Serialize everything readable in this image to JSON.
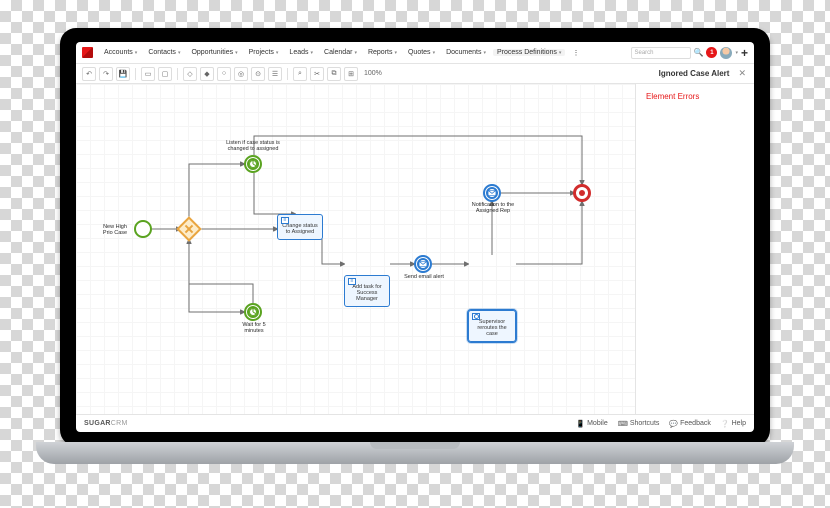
{
  "brand": {
    "strong": "SUGAR",
    "light": "CRM"
  },
  "nav": {
    "items": [
      {
        "label": "Accounts"
      },
      {
        "label": "Contacts"
      },
      {
        "label": "Opportunities"
      },
      {
        "label": "Projects"
      },
      {
        "label": "Leads"
      },
      {
        "label": "Calendar"
      },
      {
        "label": "Reports"
      },
      {
        "label": "Quotes"
      },
      {
        "label": "Documents"
      },
      {
        "label": "Process Definitions",
        "active": true
      }
    ],
    "search_placeholder": "Search",
    "notifications_count": "1"
  },
  "toolbar": {
    "buttons": {
      "undo": "↶",
      "redo": "↷",
      "save": "💾",
      "select": "▭",
      "task": "▢",
      "gateway_excl": "◇",
      "gateway_para": "◆",
      "event_start": "○",
      "event_inter": "◎",
      "event_end": "⊙",
      "note": "☰",
      "lasso": "⌕",
      "cut": "✂",
      "copy": "⧉",
      "grid": "⊞"
    },
    "zoom": "100%",
    "panel_title": "Ignored Case Alert"
  },
  "sidepanel": {
    "errors_link": "Element Errors"
  },
  "footer": {
    "mobile": "Mobile",
    "shortcuts": "Shortcuts",
    "feedback": "Feedback",
    "help": "Help"
  },
  "diagram": {
    "start": {
      "label": "New High Prio Case"
    },
    "listen": {
      "label": "Listen if case status is changed to assigned"
    },
    "change": {
      "label": "Change status to Assigned"
    },
    "waitclk": {
      "label": "Wait for 5 minutes"
    },
    "addtask": {
      "label": "Add task for Success Manager"
    },
    "sendmail": {
      "label": "Send email alert"
    },
    "notify": {
      "label": "Notification to the Assigned Rep"
    },
    "super": {
      "label": "Supervisor reroutes the case"
    }
  }
}
